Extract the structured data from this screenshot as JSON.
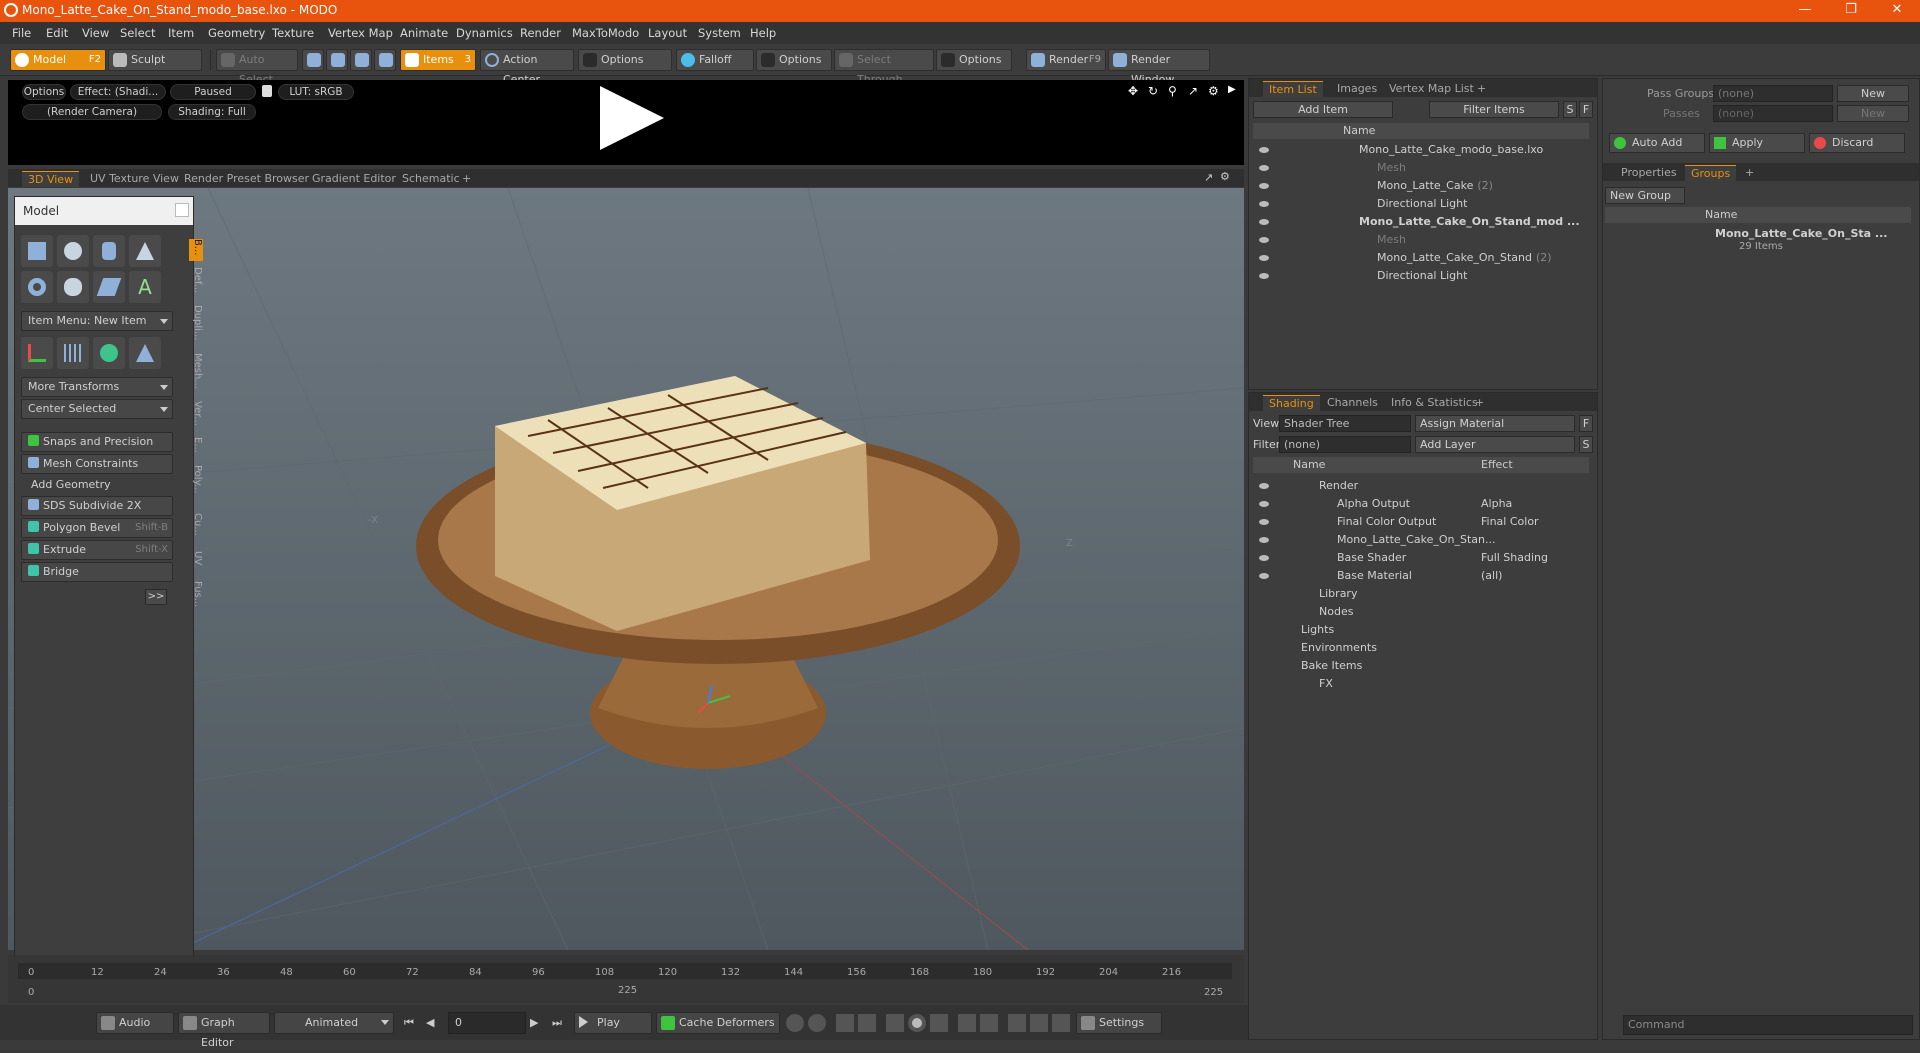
{
  "window": {
    "title": "Mono_Latte_Cake_On_Stand_modo_base.lxo - MODO"
  },
  "menu": [
    "File",
    "Edit",
    "View",
    "Select",
    "Item",
    "Geometry",
    "Texture",
    "Vertex Map",
    "Animate",
    "Dynamics",
    "Render",
    "MaxToModo",
    "Layout",
    "System",
    "Help"
  ],
  "toolbar": {
    "model": "Model",
    "model_key": "F2",
    "sculpt": "Sculpt",
    "auto_select": "Auto Select",
    "items": "Items",
    "items_key": "3",
    "action_center": "Action Center",
    "options1": "Options",
    "falloff": "Falloff",
    "options2": "Options",
    "select_through": "Select Through",
    "options3": "Options",
    "render": "Render",
    "render_key": "F9",
    "render_window": "Render Window"
  },
  "preview": {
    "options": "Options",
    "effect": "Effect: (Shadi...",
    "paused": "Paused",
    "lut": "LUT: sRGB",
    "camera": "(Render Camera)",
    "shading": "Shading: Full"
  },
  "viewtabs": [
    "3D View",
    "UV Texture View",
    "Render Preset Browser",
    "Gradient Editor",
    "Schematic",
    "+"
  ],
  "palette": {
    "title": "Model",
    "item_menu": "Item Menu: New Item",
    "more_transforms": "More Transforms",
    "center_selected": "Center Selected",
    "snaps": "Snaps and Precision",
    "mesh_constraints": "Mesh Constraints",
    "add_geometry": "Add Geometry",
    "sds": "SDS Subdivide 2X",
    "bevel": "Polygon Bevel",
    "bevel_key": "Shift-B",
    "extrude": "Extrude",
    "extrude_key": "Shift-X",
    "bridge": "Bridge",
    "more": ">>",
    "vtabs": [
      "B...",
      "Def...",
      "Dupli...",
      "Mesh...",
      "Ver...",
      "E...",
      "Poly...",
      "Cu...",
      "UV",
      "Fus..."
    ]
  },
  "viewport": {
    "axis_x_label": "-X",
    "axis_z_label": "Z"
  },
  "timeline": {
    "ticks": [
      "0",
      "12",
      "24",
      "36",
      "48",
      "60",
      "72",
      "84",
      "96",
      "108",
      "120",
      "132",
      "144",
      "156",
      "168",
      "180",
      "192",
      "204",
      "216"
    ],
    "mid": "225",
    "left": "0",
    "right": "225"
  },
  "bottombar": {
    "audio": "Audio",
    "graph_editor": "Graph Editor",
    "animated": "Animated",
    "frame": "0",
    "play": "Play",
    "cache": "Cache Deformers",
    "settings": "Settings"
  },
  "itemlist": {
    "tabs": [
      "Item List",
      "Images",
      "Vertex Map List",
      "+"
    ],
    "add_item": "Add Item",
    "filter_items": "Filter Items",
    "s": "S",
    "f": "F",
    "name_col": "Name",
    "rows": [
      {
        "label": "Mono_Latte_Cake_modo_base.lxo",
        "indent": 0,
        "style": ""
      },
      {
        "label": "Mesh",
        "indent": 1,
        "style": "dim"
      },
      {
        "label": "Mono_Latte_Cake",
        "count": "(2)",
        "indent": 1,
        "style": ""
      },
      {
        "label": "Directional Light",
        "indent": 1,
        "style": ""
      },
      {
        "label": "Mono_Latte_Cake_On_Stand_mod ...",
        "indent": 0,
        "style": "bold"
      },
      {
        "label": "Mesh",
        "indent": 1,
        "style": "dim"
      },
      {
        "label": "Mono_Latte_Cake_On_Stand",
        "count": "(2)",
        "indent": 1,
        "style": ""
      },
      {
        "label": "Directional Light",
        "indent": 1,
        "style": ""
      }
    ]
  },
  "shading": {
    "tabs": [
      "Shading",
      "Channels",
      "Info & Statistics",
      "+"
    ],
    "view_label": "View",
    "view_value": "Shader Tree",
    "assign_material": "Assign Material",
    "filter_label": "Filter",
    "filter_value": "(none)",
    "add_layer": "Add Layer",
    "s": "S",
    "f": "F",
    "name_col": "Name",
    "effect_col": "Effect",
    "rows": [
      {
        "label": "Render",
        "effect": "",
        "indent": 0
      },
      {
        "label": "Alpha Output",
        "effect": "Alpha",
        "indent": 1
      },
      {
        "label": "Final Color Output",
        "effect": "Final Color",
        "indent": 1
      },
      {
        "label": "Mono_Latte_Cake_On_Stan...",
        "effect": "",
        "indent": 1
      },
      {
        "label": "Base Shader",
        "effect": "Full Shading",
        "indent": 1
      },
      {
        "label": "Base Material",
        "effect": "(all)",
        "indent": 1
      },
      {
        "label": "Library",
        "effect": "",
        "indent": 0
      },
      {
        "label": "Nodes",
        "effect": "",
        "indent": 0
      },
      {
        "label": "Lights",
        "effect": "",
        "indent": -1
      },
      {
        "label": "Environments",
        "effect": "",
        "indent": -1
      },
      {
        "label": "Bake Items",
        "effect": "",
        "indent": -1
      },
      {
        "label": "FX",
        "effect": "",
        "indent": 0
      }
    ]
  },
  "right": {
    "pass_groups_label": "Pass Groups",
    "pass_groups_value": "(none)",
    "new": "New",
    "passes_label": "Passes",
    "passes_value": "(none)",
    "new2": "New",
    "auto_add": "Auto Add",
    "apply": "Apply",
    "discard": "Discard",
    "tabs": [
      "Properties",
      "Groups",
      "+"
    ],
    "new_group": "New Group",
    "name_col": "Name",
    "group_name": "Mono_Latte_Cake_On_Sta ...",
    "group_items": "29 Items",
    "command": "Command"
  },
  "colors": {
    "accent": "#e8900e",
    "title": "#e8530e"
  }
}
